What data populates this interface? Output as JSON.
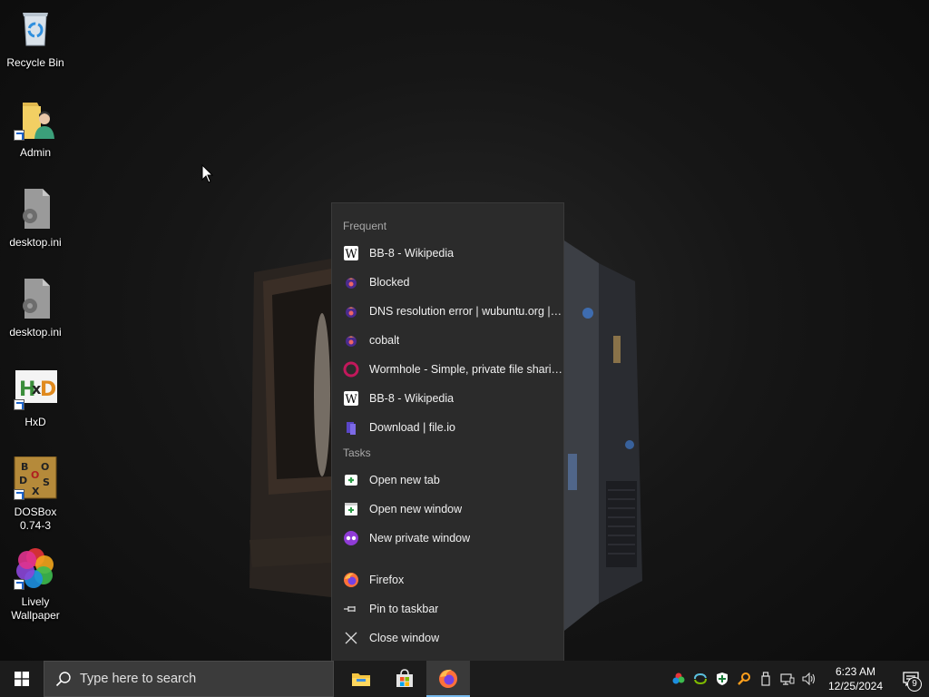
{
  "desktop": {
    "icons": [
      {
        "label": "Recycle Bin",
        "icon": "recycle-bin-icon"
      },
      {
        "label": "Admin",
        "icon": "user-folder-icon"
      },
      {
        "label": "desktop.ini",
        "icon": "settings-file-icon"
      },
      {
        "label": "desktop.ini",
        "icon": "settings-file-icon"
      },
      {
        "label": "HxD",
        "icon": "hxd-icon"
      },
      {
        "label": "DOSBox\n0.74-3",
        "icon": "dosbox-icon"
      },
      {
        "label": "Lively\nWallpaper",
        "icon": "lively-wallpaper-icon"
      }
    ]
  },
  "jumplist": {
    "frequent_header": "Frequent",
    "frequent": [
      {
        "label": "BB-8 - Wikipedia",
        "icon": "wikipedia-icon"
      },
      {
        "label": "Blocked",
        "icon": "firefox-private-icon"
      },
      {
        "label": "DNS resolution error | wubuntu.org | C...",
        "icon": "firefox-private-icon"
      },
      {
        "label": "cobalt",
        "icon": "firefox-private-icon"
      },
      {
        "label": "Wormhole - Simple, private file sharing",
        "icon": "wormhole-icon"
      },
      {
        "label": "BB-8 - Wikipedia",
        "icon": "wikipedia-icon"
      },
      {
        "label": "Download | file.io",
        "icon": "fileio-icon"
      }
    ],
    "tasks_header": "Tasks",
    "tasks": [
      {
        "label": "Open new tab",
        "icon": "new-tab-icon"
      },
      {
        "label": "Open new window",
        "icon": "new-window-icon"
      },
      {
        "label": "New private window",
        "icon": "private-window-icon"
      }
    ],
    "app": {
      "label": "Firefox",
      "icon": "firefox-icon"
    },
    "pin_label": "Pin to taskbar",
    "close_label": "Close window"
  },
  "taskbar": {
    "search_placeholder": "Type here to search",
    "apps": [
      "file-explorer-icon",
      "microsoft-store-icon",
      "firefox-icon"
    ],
    "clock_time": "6:23 AM",
    "clock_date": "12/25/2024",
    "notification_count": "9",
    "accent_color": "#76b9ed"
  }
}
